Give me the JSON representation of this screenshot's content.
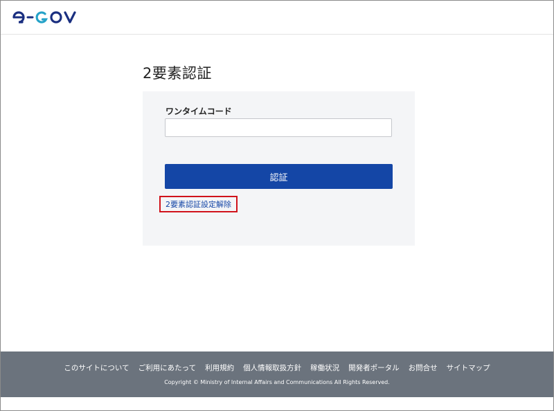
{
  "header": {
    "logo_text": "e-GOV",
    "brand_color": "#1a2f80",
    "accent_color": "#25a2c8"
  },
  "main": {
    "title": "2要素認証",
    "form": {
      "code_label": "ワンタイムコード",
      "code_value": "",
      "submit_label": "認証",
      "remove_link_label": "2要素認証設定解除"
    },
    "colors": {
      "primary_button": "#1446a6",
      "highlight_border": "#d0121b",
      "panel_background": "#f4f5f7"
    }
  },
  "footer": {
    "links": [
      "このサイトについて",
      "ご利用にあたって",
      "利用規約",
      "個人情報取扱方針",
      "稼働状況",
      "開発者ポータル",
      "お問合せ",
      "サイトマップ"
    ],
    "copyright": "Copyright © Ministry of Internal Affairs and Communications All Rights Reserved.",
    "background_color": "#6b737d"
  }
}
